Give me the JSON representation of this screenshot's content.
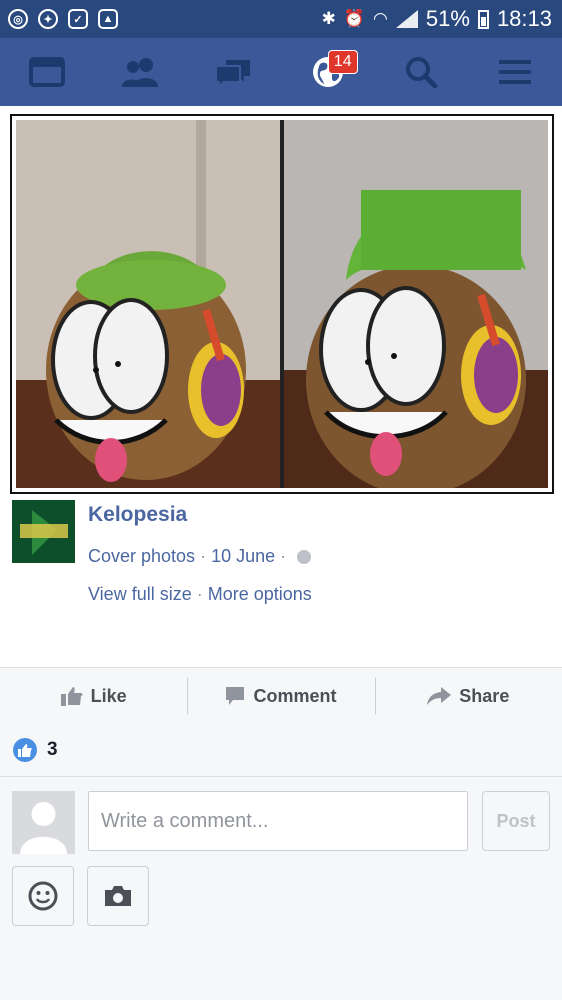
{
  "status_bar": {
    "battery": "51%",
    "time": "18:13",
    "icons": [
      "camera-icon",
      "run-icon",
      "gallery-icon",
      "gallery-icon",
      "bluetooth-icon",
      "alarm-icon",
      "wifi-icon",
      "signal-icon",
      "battery-icon"
    ]
  },
  "nav": {
    "items": [
      "newsfeed-icon",
      "friends-icon",
      "messages-icon",
      "notifications-globe-icon",
      "search-icon",
      "menu-icon"
    ],
    "notifications_badge": "14"
  },
  "post": {
    "page_name": "Kelopesia",
    "avatar_text": "Kelopesia",
    "album": "Cover photos",
    "date": "10 June",
    "privacy_icon": "globe-icon",
    "view_full_size": "View full size",
    "more_options": "More options"
  },
  "actions": {
    "like": "Like",
    "comment": "Comment",
    "share": "Share"
  },
  "reactions": {
    "like_count": "3"
  },
  "composer": {
    "placeholder": "Write a comment...",
    "post_label": "Post"
  },
  "colors": {
    "status_bar": "#29487d",
    "nav_bar": "#3b5998",
    "link": "#4b67a1",
    "badge": "#e0372c",
    "like_blue": "#4a90e2"
  }
}
